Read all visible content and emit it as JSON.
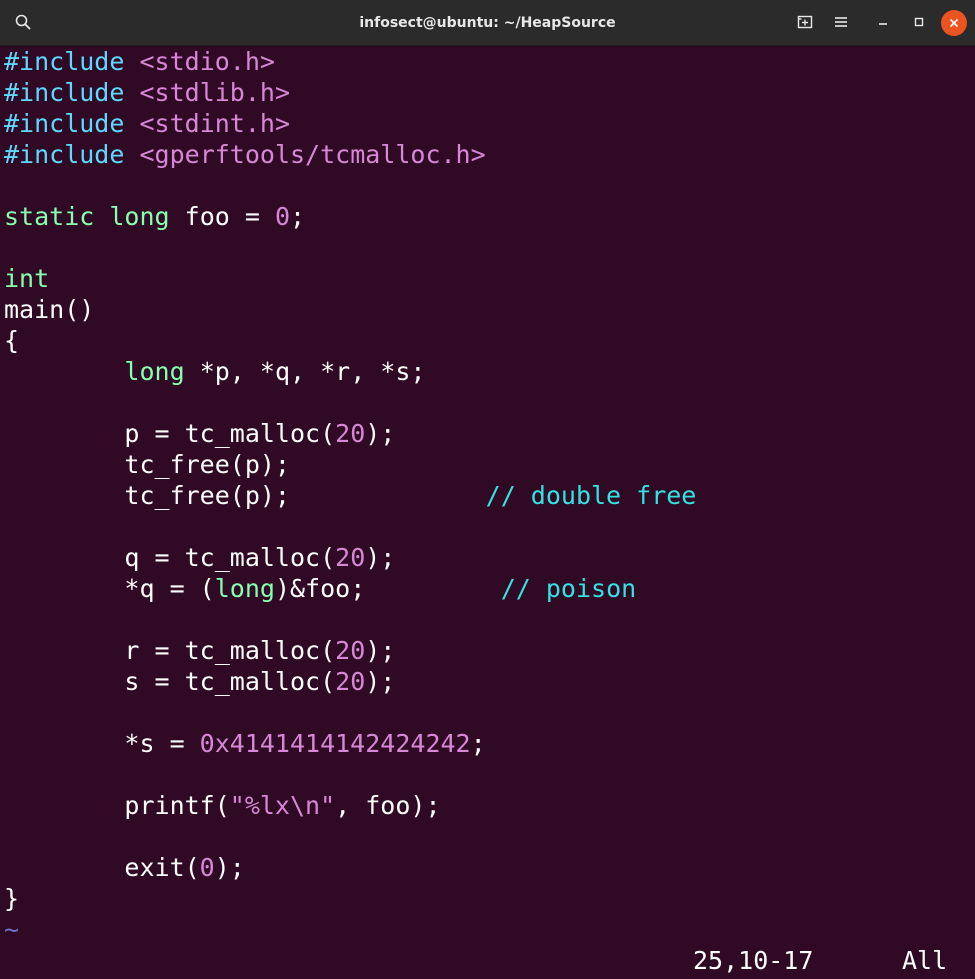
{
  "window": {
    "title": "infosect@ubuntu: ~/HeapSource"
  },
  "icons": {
    "search": "search-icon",
    "new_tab": "new-tab-icon",
    "menu": "hamburger-menu-icon",
    "minimize": "minimize-icon",
    "maximize": "maximize-icon",
    "close": "close-icon"
  },
  "colors": {
    "background": "#300a24",
    "preprocessor": "#5fd7ff",
    "string": "#d787d7",
    "type": "#87ffaf",
    "comment": "#34e2e2",
    "close_button": "#e95420"
  },
  "code": {
    "l1": {
      "a": "#include",
      "b": " ",
      "c": "<stdio.h>"
    },
    "l2": {
      "a": "#include",
      "b": " ",
      "c": "<stdlib.h>"
    },
    "l3": {
      "a": "#include",
      "b": " ",
      "c": "<stdint.h>"
    },
    "l4": {
      "a": "#include",
      "b": " ",
      "c": "<gperftools/tcmalloc.h>"
    },
    "l6": {
      "a": "static",
      "b": " ",
      "c": "long",
      "d": " foo = ",
      "e": "0",
      "f": ";"
    },
    "l8": {
      "a": "int"
    },
    "l9": {
      "a": "main()"
    },
    "l10": {
      "a": "{"
    },
    "l11": {
      "a": "        ",
      "b": "long",
      "c": " *p, *q, *r, *s;"
    },
    "l13": {
      "a": "        p = tc_malloc(",
      "b": "20",
      "c": ");"
    },
    "l14": {
      "a": "        tc_free(p);"
    },
    "l15": {
      "a": "        tc_free(p);             ",
      "b": "// double free"
    },
    "l17": {
      "a": "        q = tc_malloc(",
      "b": "20",
      "c": ");"
    },
    "l18": {
      "a": "        *q = (",
      "b": "long",
      "c": ")&foo;         ",
      "d": "// poison"
    },
    "l20": {
      "a": "        r = tc_malloc(",
      "b": "20",
      "c": ");"
    },
    "l21": {
      "a": "        s = tc_malloc(",
      "b": "20",
      "c": ");"
    },
    "l23": {
      "a": "        *s = ",
      "b": "0x4141414142424242",
      "c": ";"
    },
    "l25": {
      "a": "        printf(",
      "b": "\"%lx\\n\"",
      "c": ", foo);"
    },
    "l27": {
      "a": "        exit(",
      "b": "0",
      "c": ");"
    },
    "l28": {
      "a": "}"
    },
    "l29": {
      "a": "~"
    }
  },
  "status": {
    "position": "25,10-17",
    "scroll": "All"
  }
}
